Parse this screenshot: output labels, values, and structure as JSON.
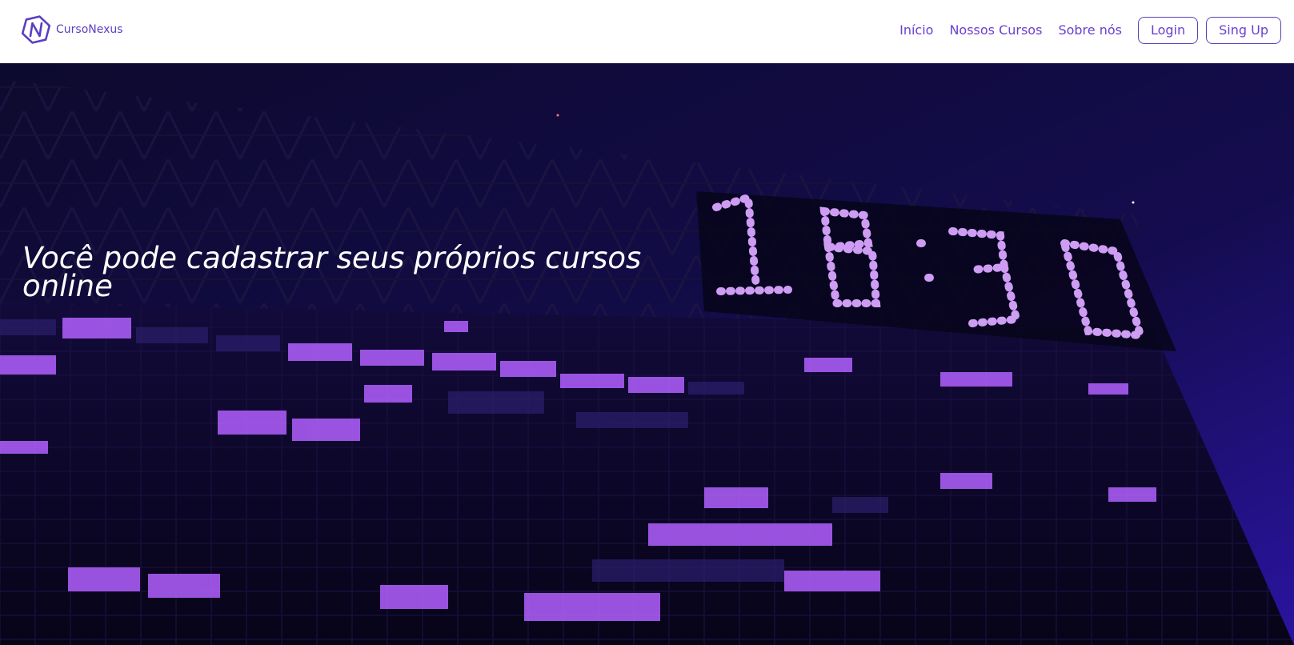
{
  "header": {
    "brand_name": "CursoNexus",
    "logo_icon": "hexagon-n-logo-icon",
    "nav_links": [
      "Início",
      "Nossos Cursos",
      "Sobre nós"
    ],
    "login_label": "Login",
    "signup_label": "Sing Up"
  },
  "hero": {
    "title": "Você pode cadastrar seus próprios cursos online",
    "background_image": "night building with purple LED clock",
    "clock_display": "18:30"
  },
  "colors": {
    "accent": "#6a3fd1",
    "brand": "#5a3fc0",
    "hero_bg": "#0c0830",
    "window_glow": "#b260ff"
  }
}
